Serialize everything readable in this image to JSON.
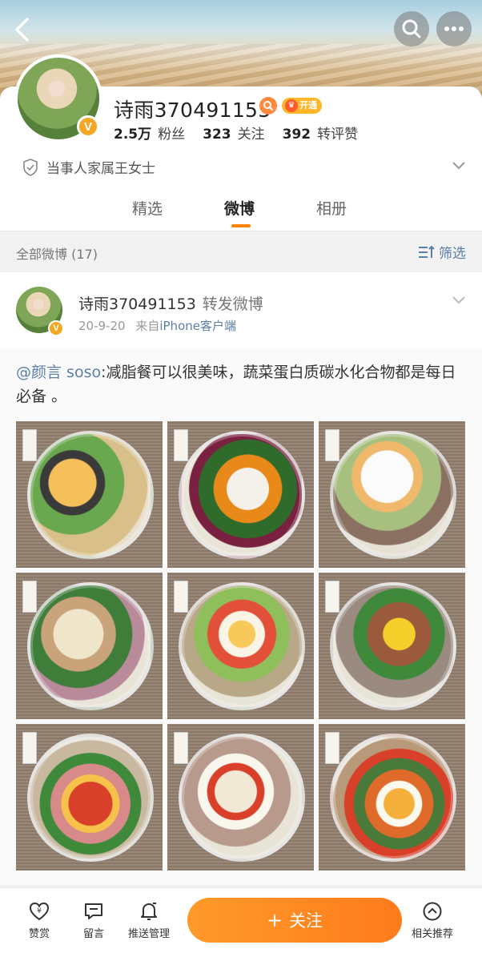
{
  "profile": {
    "name": "诗雨370491153",
    "badge_open": "开通",
    "verified_mark": "V",
    "followers_count": "2.5万",
    "followers_label": "粉丝",
    "following_count": "323",
    "following_label": "关注",
    "reposts_count": "392",
    "reposts_label": "转评赞",
    "bio": "当事人家属王女士"
  },
  "tabs": [
    {
      "label": "精选",
      "active": false
    },
    {
      "label": "微博",
      "active": true
    },
    {
      "label": "相册",
      "active": false
    }
  ],
  "filter": {
    "all_label": "全部微博 (17)",
    "filter_label": "筛选"
  },
  "post": {
    "author": "诗雨370491153",
    "action": "转发微博",
    "date": "20-9-20",
    "from_prefix": "来自",
    "source": "iPhone客户端",
    "mention": "@颜言 soso",
    "text": ":减脂餐可以很美味，蔬菜蛋白质碳水化合物都是每日必备 。",
    "image_count": 9
  },
  "bottom_bar": {
    "reward_label": "赞赏",
    "message_label": "留言",
    "push_label": "推送管理",
    "follow_label": "关注",
    "recommend_label": "相关推荐"
  },
  "colors": {
    "accent": "#ff8200",
    "link": "#5b7fa8",
    "verified": "#f5a623"
  }
}
